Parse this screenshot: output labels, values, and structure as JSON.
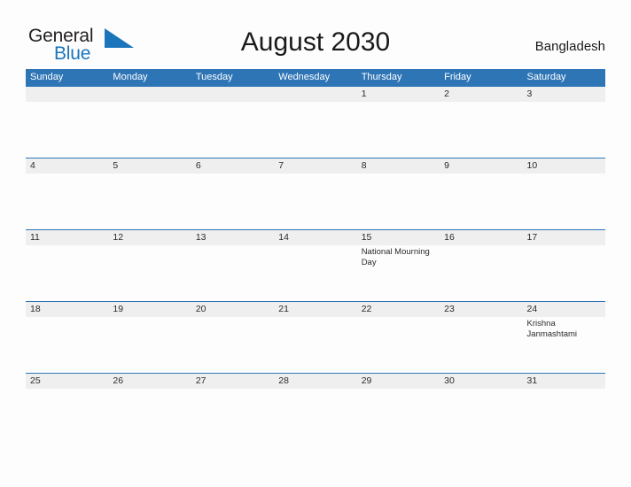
{
  "header": {
    "logo": {
      "word_one": "General",
      "word_two": "Blue",
      "flag_icon": "blue-flag-triangle-icon",
      "color_dark": "#231f20",
      "color_blue": "#1b75bb"
    },
    "title": "August 2030",
    "country": "Bangladesh"
  },
  "theme": {
    "header_blue": "#2e75b6",
    "date_band_gray": "#efefef",
    "page_background": "#fdfdfd",
    "text_color": "#2b2b2b"
  },
  "calendar": {
    "month": "August",
    "year": "2030",
    "weekdays": [
      "Sunday",
      "Monday",
      "Tuesday",
      "Wednesday",
      "Thursday",
      "Friday",
      "Saturday"
    ],
    "weeks": [
      [
        {
          "date": "",
          "holiday": ""
        },
        {
          "date": "",
          "holiday": ""
        },
        {
          "date": "",
          "holiday": ""
        },
        {
          "date": "",
          "holiday": ""
        },
        {
          "date": "1",
          "holiday": ""
        },
        {
          "date": "2",
          "holiday": ""
        },
        {
          "date": "3",
          "holiday": ""
        }
      ],
      [
        {
          "date": "4",
          "holiday": ""
        },
        {
          "date": "5",
          "holiday": ""
        },
        {
          "date": "6",
          "holiday": ""
        },
        {
          "date": "7",
          "holiday": ""
        },
        {
          "date": "8",
          "holiday": ""
        },
        {
          "date": "9",
          "holiday": ""
        },
        {
          "date": "10",
          "holiday": ""
        }
      ],
      [
        {
          "date": "11",
          "holiday": ""
        },
        {
          "date": "12",
          "holiday": ""
        },
        {
          "date": "13",
          "holiday": ""
        },
        {
          "date": "14",
          "holiday": ""
        },
        {
          "date": "15",
          "holiday": "National Mourning Day"
        },
        {
          "date": "16",
          "holiday": ""
        },
        {
          "date": "17",
          "holiday": ""
        }
      ],
      [
        {
          "date": "18",
          "holiday": ""
        },
        {
          "date": "19",
          "holiday": ""
        },
        {
          "date": "20",
          "holiday": ""
        },
        {
          "date": "21",
          "holiday": ""
        },
        {
          "date": "22",
          "holiday": ""
        },
        {
          "date": "23",
          "holiday": ""
        },
        {
          "date": "24",
          "holiday": "Krishna Janmashtami"
        }
      ],
      [
        {
          "date": "25",
          "holiday": ""
        },
        {
          "date": "26",
          "holiday": ""
        },
        {
          "date": "27",
          "holiday": ""
        },
        {
          "date": "28",
          "holiday": ""
        },
        {
          "date": "29",
          "holiday": ""
        },
        {
          "date": "30",
          "holiday": ""
        },
        {
          "date": "31",
          "holiday": ""
        }
      ]
    ]
  }
}
